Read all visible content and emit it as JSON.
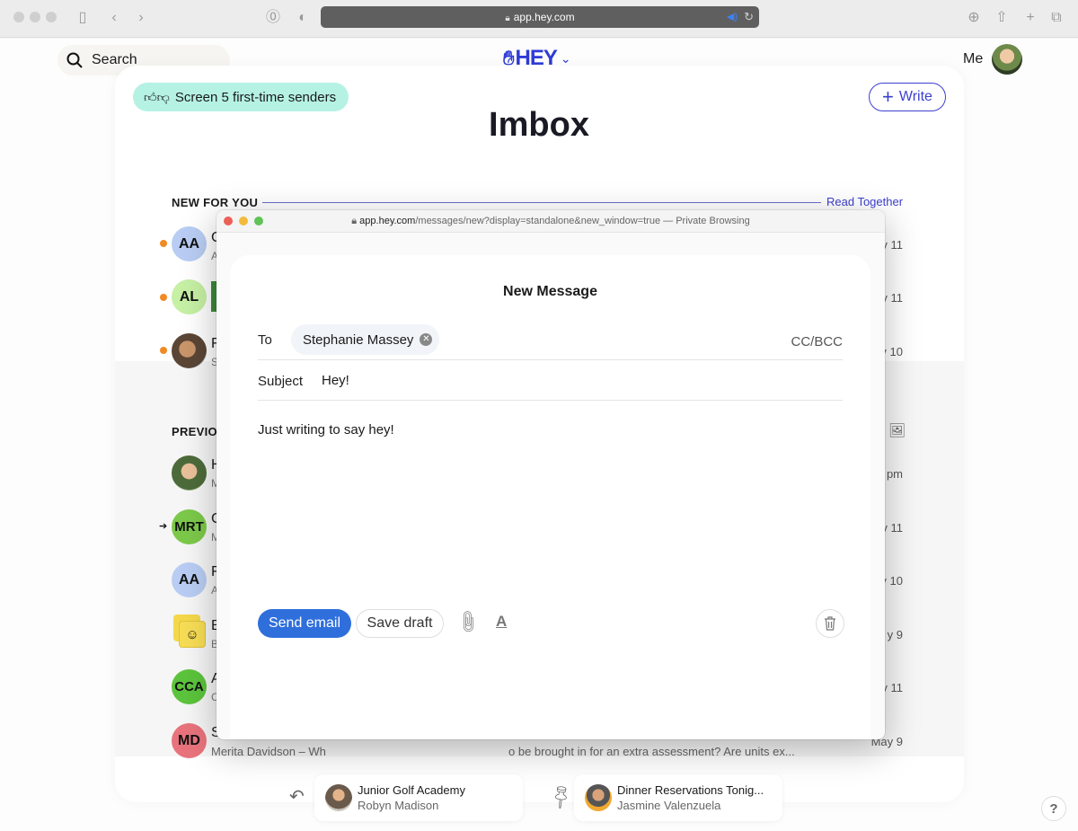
{
  "browser": {
    "url": "app.hey.com",
    "toolbar_icons": [
      "sidebar-icon",
      "back-icon",
      "forward-icon",
      "password-icon",
      "shield-icon",
      "download-icon",
      "share-icon",
      "new-tab-icon",
      "tabs-overview-icon"
    ]
  },
  "header": {
    "search_label": "Search",
    "logo_text": "HEY",
    "account_label": "Me"
  },
  "imbox": {
    "screener_label": "Screen 5 first-time senders",
    "write_label": "Write",
    "title": "Imbox",
    "new_section_label": "NEW FOR YOU",
    "read_together_label": "Read Together",
    "previous_section_label": "PREVIO",
    "new_rows": [
      {
        "avatar": "AA",
        "avatar_color": "#b9cdf4",
        "initial": "C",
        "sub": "A",
        "date": "y 11",
        "unread": true
      },
      {
        "avatar": "AL",
        "avatar_color": "#c6f0a4",
        "initial": "",
        "sub": "",
        "date": "y 11",
        "unread": true
      },
      {
        "avatar": "photo",
        "avatar_color": "#6b5a4a",
        "initial": "F",
        "sub": "S",
        "date": "y 10",
        "unread": true
      }
    ],
    "previous_rows": [
      {
        "avatar": "photo",
        "avatar_color": "#7c9a5c",
        "initial": "H",
        "sub": "M",
        "date": "pm"
      },
      {
        "avatar": "MRT",
        "avatar_color": "#7cc94a",
        "initial": "C",
        "sub": "M",
        "date": "y 11",
        "arrow": true
      },
      {
        "avatar": "AA",
        "avatar_color": "#b9cdf4",
        "initial": "F",
        "sub": "A",
        "date": "y 10"
      },
      {
        "avatar": "basecamp",
        "avatar_color": "#f5d84a",
        "initial": "B",
        "sub": "B",
        "date": "y 9"
      },
      {
        "avatar": "CCA",
        "avatar_color": "#5cc43c",
        "initial": "A",
        "sub": "C",
        "date": "y 11"
      },
      {
        "avatar": "MD",
        "avatar_color": "#e8737c",
        "initial": "S",
        "sub": "Merita Davidson – Wh",
        "sub_tail": "o be brought in for an extra assessment? Are units ex...",
        "date": "May 9"
      }
    ],
    "bottom_chips": [
      {
        "icon": "reply-later-icon",
        "title": "Junior Golf Academy",
        "sub": "Robyn Madison"
      },
      {
        "icon": "pin-icon",
        "title": "Dinner Reservations Tonig...",
        "sub": "Jasmine Valenzuela"
      }
    ],
    "help_label": "?"
  },
  "compose_window": {
    "url_host": "app.hey.com",
    "url_path": "/messages/new?display=standalone&new_window=true",
    "url_suffix": " — Private Browsing",
    "title": "New Message",
    "to_label": "To",
    "recipient": "Stephanie Massey",
    "cc_bcc_label": "CC/BCC",
    "subject_label": "Subject",
    "subject_value": "Hey!",
    "body": "Just writing to say hey!",
    "send_label": "Send email",
    "draft_label": "Save draft"
  },
  "colors": {
    "brand": "#2f3bd6",
    "accent": "#3c3fcf",
    "send": "#2f6fdc",
    "screener": "#b5f2e4",
    "unread_dot": "#f08a24"
  }
}
